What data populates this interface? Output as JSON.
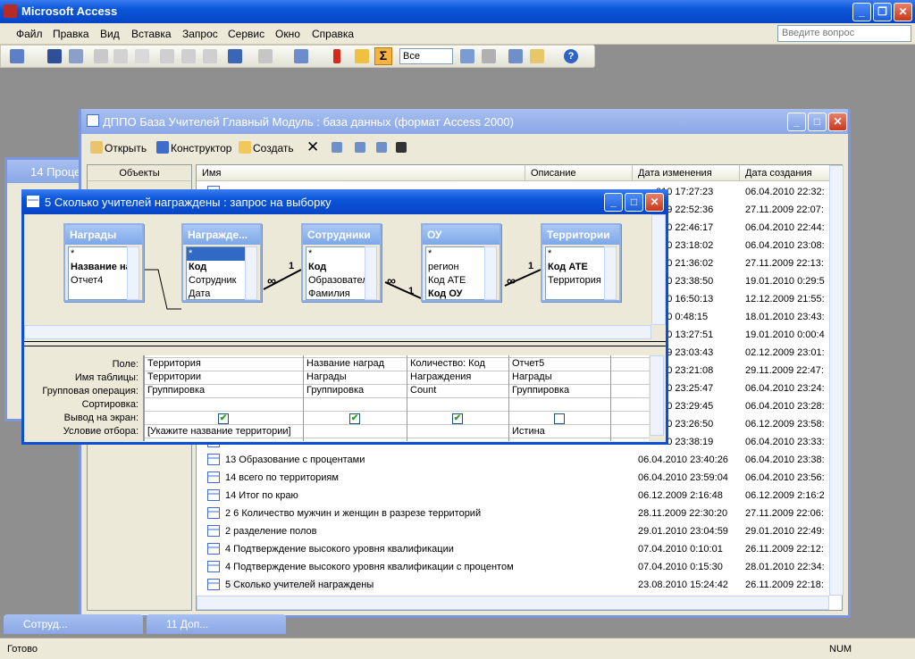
{
  "app": {
    "title": "Microsoft Access"
  },
  "menu": [
    "Файл",
    "Правка",
    "Вид",
    "Вставка",
    "Запрос",
    "Сервис",
    "Окно",
    "Справка"
  ],
  "help": {
    "placeholder": "Введите вопрос"
  },
  "toolbar": {
    "combo_value": "Все"
  },
  "status": {
    "left": "Готово",
    "num": "NUM"
  },
  "db_window": {
    "title": "ДППО База Учителей Главный Модуль  : база данных (формат Access 2000)",
    "buttons": [
      "Открыть",
      "Конструктор",
      "Создать"
    ],
    "objects_header": "Объекты",
    "columns": [
      "Имя",
      "Описание",
      "Дата изменения",
      "Дата создания"
    ],
    "rows": [
      {
        "name": "",
        "modified": "010 17:27:23",
        "created": "06.04.2010 22:32:"
      },
      {
        "name": "",
        "modified": "009 22:52:36",
        "created": "27.11.2009 22:07:"
      },
      {
        "name": "",
        "modified": "010 22:46:17",
        "created": "06.04.2010 22:44:"
      },
      {
        "name": "",
        "modified": "010 23:18:02",
        "created": "06.04.2010 23:08:"
      },
      {
        "name": "",
        "modified": "010 21:36:02",
        "created": "27.11.2009 22:13:"
      },
      {
        "name": "",
        "modified": "010 23:38:50",
        "created": "19.01.2010 0:29:5"
      },
      {
        "name": "",
        "modified": "010 16:50:13",
        "created": "12.12.2009 21:55:"
      },
      {
        "name": "",
        "modified": "010 0:48:15",
        "created": "18.01.2010 23:43:"
      },
      {
        "name": "",
        "modified": "010 13:27:51",
        "created": "19.01.2010 0:00:4"
      },
      {
        "name": "",
        "modified": "009 23:03:43",
        "created": "02.12.2009 23:01:"
      },
      {
        "name": "",
        "modified": "010 23:21:08",
        "created": "29.11.2009 22:47:"
      },
      {
        "name": "",
        "modified": "010 23:25:47",
        "created": "06.04.2010 23:24:"
      },
      {
        "name": "",
        "modified": "010 23:29:45",
        "created": "06.04.2010 23:28:"
      },
      {
        "name": "",
        "modified": "010 23:26:50",
        "created": "06.12.2009 23:58:"
      },
      {
        "name": "",
        "modified": "010 23:38:19",
        "created": "06.04.2010 23:33:"
      },
      {
        "name": "13 Образование с процентами",
        "modified": "06.04.2010 23:40:26",
        "created": "06.04.2010 23:38:"
      },
      {
        "name": "14 всего по  территориям",
        "modified": "06.04.2010 23:59:04",
        "created": "06.04.2010 23:56:"
      },
      {
        "name": "14 Итог по краю",
        "modified": "06.12.2009 2:16:48",
        "created": "06.12.2009 2:16:2"
      },
      {
        "name": "2 6 Количество мужчин и женщин в разрезе территорий",
        "modified": "28.11.2009 22:30:20",
        "created": "27.11.2009 22:06:"
      },
      {
        "name": "2 разделение полов",
        "modified": "29.01.2010 23:04:59",
        "created": "29.01.2010 22:49:"
      },
      {
        "name": "4 Подтверждение высокого уровня квалификации",
        "modified": "07.04.2010 0:10:01",
        "created": "26.11.2009 22:12:"
      },
      {
        "name": "4 Подтверждение высокого уровня квалификации с процентом",
        "modified": "07.04.2010 0:15:30",
        "created": "28.01.2010 22:34:"
      },
      {
        "name": "5 Сколько учителей награждены",
        "modified": "23.08.2010 15:24:42",
        "created": "26.11.2009 22:18:"
      }
    ]
  },
  "bg_window": {
    "title": "14 Проце"
  },
  "min_windows": [
    "Сотруд...",
    "11 Доп..."
  ],
  "query": {
    "title": "5 Сколько учителей награждены : запрос на выборку",
    "tables": [
      {
        "title": "Награды",
        "fields": [
          "*",
          "Название наг",
          "Отчет4"
        ]
      },
      {
        "title": "Награжде...",
        "fields": [
          "*",
          "Код",
          "Сотрудник",
          "Дата"
        ]
      },
      {
        "title": "Сотрудники",
        "fields": [
          "*",
          "Код",
          "Образовател",
          "Фамилия"
        ]
      },
      {
        "title": "ОУ",
        "fields": [
          "*",
          "регион",
          "Код АТЕ",
          "Код ОУ"
        ]
      },
      {
        "title": "Территории",
        "fields": [
          "*",
          "Код АТЕ",
          "Территория"
        ]
      }
    ],
    "rel_labels": [
      "1",
      "∞",
      "∞",
      "1",
      "∞",
      "1"
    ],
    "grid_labels": [
      "Поле:",
      "Имя таблицы:",
      "Групповая операция:",
      "Сортировка:",
      "Вывод на экран:",
      "Условие отбора:"
    ],
    "columns": [
      {
        "field": "Территория",
        "table": "Территории",
        "group": "Группировка",
        "sort": "",
        "show": true,
        "criteria": "[Укажите название территории]"
      },
      {
        "field": "Название наград",
        "table": "Награды",
        "group": "Группировка",
        "sort": "",
        "show": true,
        "criteria": ""
      },
      {
        "field": "Количество: Код",
        "table": "Награждения",
        "group": "Count",
        "sort": "",
        "show": true,
        "criteria": ""
      },
      {
        "field": "Отчет5",
        "table": "Награды",
        "group": "Группировка",
        "sort": "",
        "show": false,
        "criteria": "Истина"
      }
    ]
  }
}
